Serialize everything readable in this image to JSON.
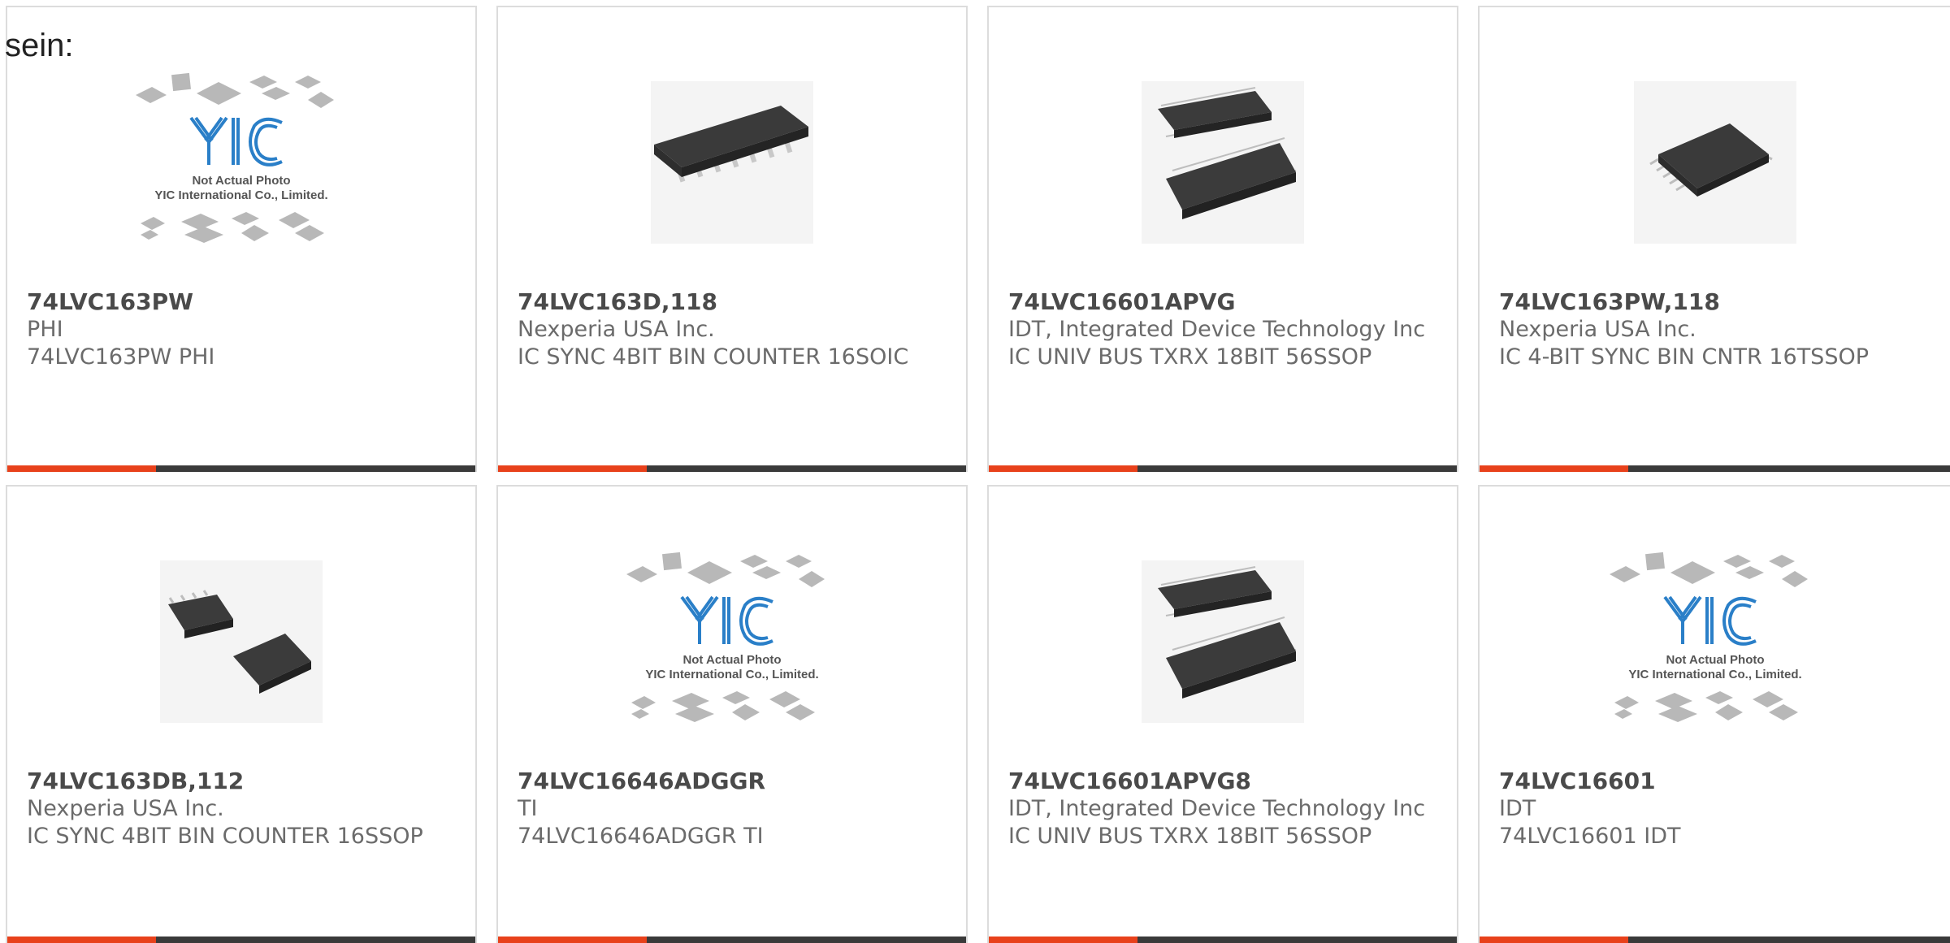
{
  "intro_text": "sein:",
  "colors": {
    "accent": "#e8411b",
    "bar": "#3a3a3a",
    "border": "#dcdcdc",
    "yic_blue": "#2a7fc8"
  },
  "placeholder": {
    "line1": "Not Actual Photo",
    "line2": "YIC International Co., Limited.",
    "logo": "YIC"
  },
  "products": [
    {
      "part": "74LVC163PW",
      "maker": "PHI",
      "desc": "74LVC163PW PHI",
      "image": "yic-placeholder-icon"
    },
    {
      "part": "74LVC163D,118",
      "maker": "Nexperia USA Inc.",
      "desc": "IC SYNC 4BIT BIN COUNTER 16SOIC",
      "image": "soic-chip-icon"
    },
    {
      "part": "74LVC16601APVG",
      "maker": "IDT, Integrated Device Technology Inc",
      "desc": "IC UNIV BUS TXRX 18BIT 56SSOP",
      "image": "ssop-56-chip-icon"
    },
    {
      "part": "74LVC163PW,118",
      "maker": "Nexperia USA Inc.",
      "desc": "IC 4-BIT SYNC BIN CNTR 16TSSOP",
      "image": "tssop-chip-icon"
    },
    {
      "part": "74LVC163DB,112",
      "maker": "Nexperia USA Inc.",
      "desc": "IC SYNC 4BIT BIN COUNTER 16SSOP",
      "image": "ssop-16-chip-icon"
    },
    {
      "part": "74LVC16646ADGGR",
      "maker": "TI",
      "desc": "74LVC16646ADGGR TI",
      "image": "yic-placeholder-icon"
    },
    {
      "part": "74LVC16601APVG8",
      "maker": "IDT, Integrated Device Technology Inc",
      "desc": "IC UNIV BUS TXRX 18BIT 56SSOP",
      "image": "ssop-56-chip-icon"
    },
    {
      "part": "74LVC16601",
      "maker": "IDT",
      "desc": "74LVC16601 IDT",
      "image": "yic-placeholder-icon"
    }
  ]
}
